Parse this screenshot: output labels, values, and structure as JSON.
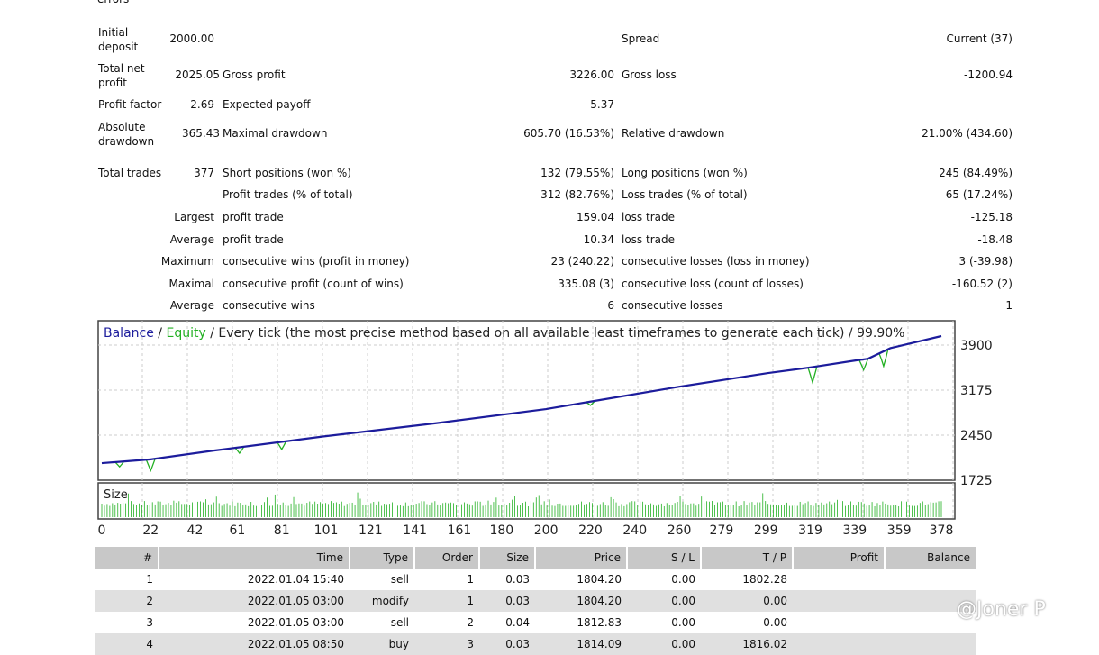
{
  "report": {
    "errors_label": "errors",
    "initial_deposit": {
      "label": "Initial deposit",
      "value": "2000.00"
    },
    "spread": {
      "label": "Spread",
      "value": "Current (37)"
    },
    "total_net_profit": {
      "label": "Total net profit",
      "value": "2025.05"
    },
    "gross_profit": {
      "label": "Gross profit",
      "value": "3226.00"
    },
    "gross_loss": {
      "label": "Gross loss",
      "value": "-1200.94"
    },
    "profit_factor": {
      "label": "Profit factor",
      "value": "2.69"
    },
    "expected_payoff": {
      "label": "Expected payoff",
      "value": "5.37"
    },
    "absolute_drawdown": {
      "label": "Absolute drawdown",
      "value": "365.43"
    },
    "maximal_drawdown": {
      "label": "Maximal drawdown",
      "value": "605.70 (16.53%)"
    },
    "relative_drawdown": {
      "label": "Relative drawdown",
      "value": "21.00% (434.60)"
    },
    "total_trades": {
      "label": "Total trades",
      "value": "377"
    },
    "short_positions": {
      "label": "Short positions (won %)",
      "value": "132 (79.55%)"
    },
    "long_positions": {
      "label": "Long positions (won %)",
      "value": "245 (84.49%)"
    },
    "profit_trades": {
      "label": "Profit trades (% of total)",
      "value": "312 (82.76%)"
    },
    "loss_trades": {
      "label": "Loss trades (% of total)",
      "value": "65 (17.24%)"
    },
    "rows": [
      {
        "prefix": "Largest",
        "l1": "profit trade",
        "v1": "159.04",
        "l2": "loss trade",
        "v2": "-125.18"
      },
      {
        "prefix": "Average",
        "l1": "profit trade",
        "v1": "10.34",
        "l2": "loss trade",
        "v2": "-18.48"
      },
      {
        "prefix": "Maximum",
        "l1": "consecutive wins (profit in money)",
        "v1": "23 (240.22)",
        "l2": "consecutive losses (loss in money)",
        "v2": "3 (-39.98)"
      },
      {
        "prefix": "Maximal",
        "l1": "consecutive profit (count of wins)",
        "v1": "335.08 (3)",
        "l2": "consecutive loss (count of losses)",
        "v2": "-160.52 (2)"
      },
      {
        "prefix": "Average",
        "l1": "consecutive wins",
        "v1": "6",
        "l2": "consecutive losses",
        "v2": "1"
      }
    ]
  },
  "chart_data": {
    "type": "line",
    "title_balance": "Balance",
    "title_sep1": " / ",
    "title_equity": "Equity",
    "title_rest": " / Every tick (the most precise method based on all available least timeframes to generate each tick) / 99.90%",
    "size_label": "Size",
    "colors": {
      "balance": "#1c1c9c",
      "equity": "#22b022",
      "size": "#22b022"
    },
    "y_ticks": [
      "3900",
      "3175",
      "2450",
      "1725"
    ],
    "x_ticks": [
      "0",
      "22",
      "42",
      "61",
      "81",
      "101",
      "121",
      "141",
      "161",
      "180",
      "200",
      "220",
      "240",
      "260",
      "279",
      "299",
      "319",
      "339",
      "359",
      "378"
    ],
    "xlim": [
      0,
      378
    ],
    "ylim": [
      1725,
      4100
    ],
    "balance": [
      [
        0,
        2000
      ],
      [
        22,
        2060
      ],
      [
        50,
        2200
      ],
      [
        100,
        2430
      ],
      [
        150,
        2640
      ],
      [
        200,
        2870
      ],
      [
        220,
        2990
      ],
      [
        260,
        3230
      ],
      [
        300,
        3450
      ],
      [
        319,
        3540
      ],
      [
        339,
        3650
      ],
      [
        345,
        3680
      ],
      [
        355,
        3850
      ],
      [
        378,
        4045
      ]
    ],
    "equity_dips": [
      [
        8,
        1940
      ],
      [
        22,
        1880
      ],
      [
        62,
        2160
      ],
      [
        81,
        2220
      ],
      [
        220,
        2930
      ],
      [
        320,
        3300
      ],
      [
        343,
        3500
      ],
      [
        352,
        3560
      ]
    ]
  },
  "trades": {
    "headers": [
      "#",
      "Time",
      "Type",
      "Order",
      "Size",
      "Price",
      "S / L",
      "T / P",
      "Profit",
      "Balance"
    ],
    "rows": [
      [
        "1",
        "2022.01.04 15:40",
        "sell",
        "1",
        "0.03",
        "1804.20",
        "0.00",
        "1802.28",
        "",
        ""
      ],
      [
        "2",
        "2022.01.05 03:00",
        "modify",
        "1",
        "0.03",
        "1804.20",
        "0.00",
        "0.00",
        "",
        ""
      ],
      [
        "3",
        "2022.01.05 03:00",
        "sell",
        "2",
        "0.04",
        "1812.83",
        "0.00",
        "0.00",
        "",
        ""
      ],
      [
        "4",
        "2022.01.05 08:50",
        "buy",
        "3",
        "0.03",
        "1814.09",
        "0.00",
        "1816.02",
        "",
        ""
      ]
    ]
  },
  "watermark": "@Joner P"
}
